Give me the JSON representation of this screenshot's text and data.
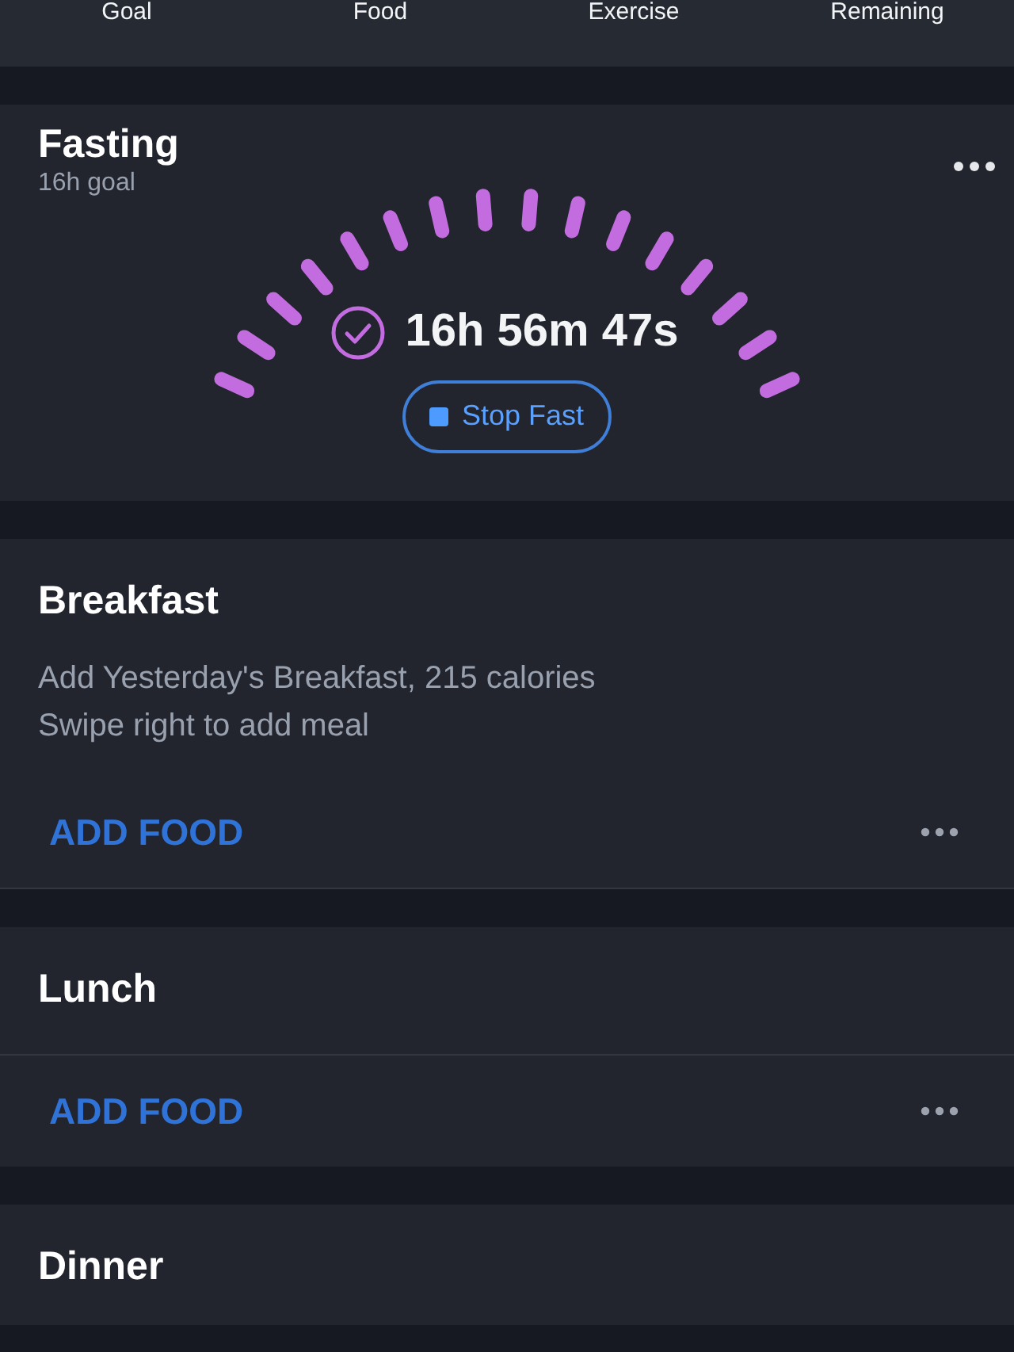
{
  "summary_columns": [
    "Goal",
    "Food",
    "Exercise",
    "Remaining"
  ],
  "fasting": {
    "title": "Fasting",
    "goal": "16h goal",
    "elapsed": "16h 56m 47s",
    "completed": true,
    "stop_button": "Stop Fast"
  },
  "meals": [
    {
      "name": "Breakfast",
      "lines": [
        "Add Yesterday's Breakfast, 215 calories",
        "Swipe right to add meal"
      ],
      "add_label": "ADD FOOD"
    },
    {
      "name": "Lunch",
      "add_label": "ADD FOOD"
    },
    {
      "name": "Dinner"
    }
  ]
}
